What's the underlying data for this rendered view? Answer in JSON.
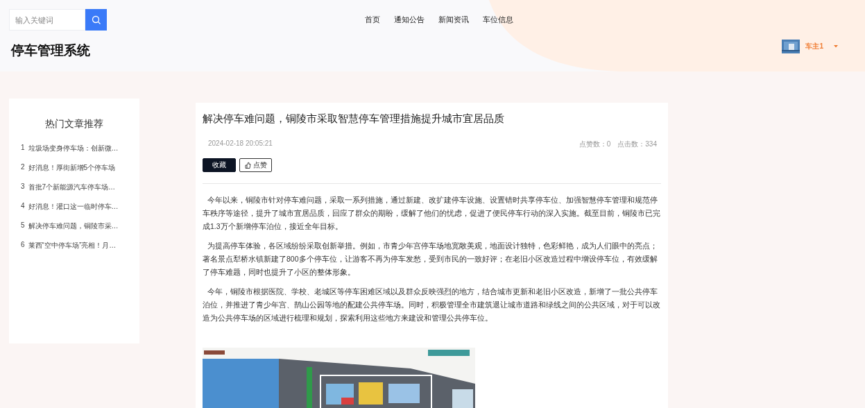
{
  "header": {
    "search": {
      "placeholder": "输入关键词"
    },
    "nav": [
      {
        "label": "首页"
      },
      {
        "label": "通知公告"
      },
      {
        "label": "新闻资讯"
      },
      {
        "label": "车位信息"
      }
    ],
    "site_title": "停车管理系统",
    "user": {
      "name": "车主1"
    }
  },
  "sidebar": {
    "title": "热门文章推荐",
    "items": [
      {
        "rank": "1",
        "title": "垃圾场变身停车场：创新微…"
      },
      {
        "rank": "2",
        "title": "好消息！厚街新增5个停车场"
      },
      {
        "rank": "3",
        "title": "首批7个新能源汽车停车场…"
      },
      {
        "rank": "4",
        "title": "好消息！灌口这一临时停车…"
      },
      {
        "rank": "5",
        "title": "解决停车难问题，铜陵市采…"
      },
      {
        "rank": "6",
        "title": "莱西“空中停车场”亮相！月…"
      }
    ]
  },
  "article": {
    "title": "解决停车难问题，铜陵市采取智慧停车管理措施提升城市宜居品质",
    "date": "2024-02-18 20:05:21",
    "likes": "点赞数：0",
    "clicks": "点击数：334",
    "buttons": [
      {
        "kind": "primary",
        "label": "收藏"
      },
      {
        "kind": "like",
        "label": "点赞"
      }
    ],
    "paragraphs": [
      "今年以来，铜陵市针对停车难问题，采取一系列措施，通过新建、改扩建停车设施、设置错时共享停车位、加强智慧停车管理和规范停车秩序等途径，提升了城市宜居品质，回应了群众的期盼，缓解了他们的忧虑，促进了便民停车行动的深入实施。截至目前，铜陵市已完成1.3万个新增停车泊位，接近全年目标。",
      "为提高停车体验，各区域纷纷采取创新举措。例如，市青少年宫停车场地宽敞美观，地面设计独特，色彩鲜艳，成为人们眼中的亮点；著名景点犁桥水镇新建了800多个停车位，让游客不再为停车发愁，受到市民的一致好评；在老旧小区改造过程中增设停车位，有效缓解了停车难题，同时也提升了小区的整体形象。",
      "今年，铜陵市根据医院、学校、老城区等停车困难区域以及群众反映强烈的地方，结合城市更新和老旧小区改造，新增了一批公共停车泊位，并推进了青少年宫、鹊山公园等地的配建公共停车场。同时，积极管理全市建筑退让城市道路和绿线之间的公共区域，对于可以改造为公共停车场的区域进行梳理和规划，探索利用这些地方来建设和管理公共停车位。"
    ],
    "image": {
      "kind": "picture"
    }
  }
}
